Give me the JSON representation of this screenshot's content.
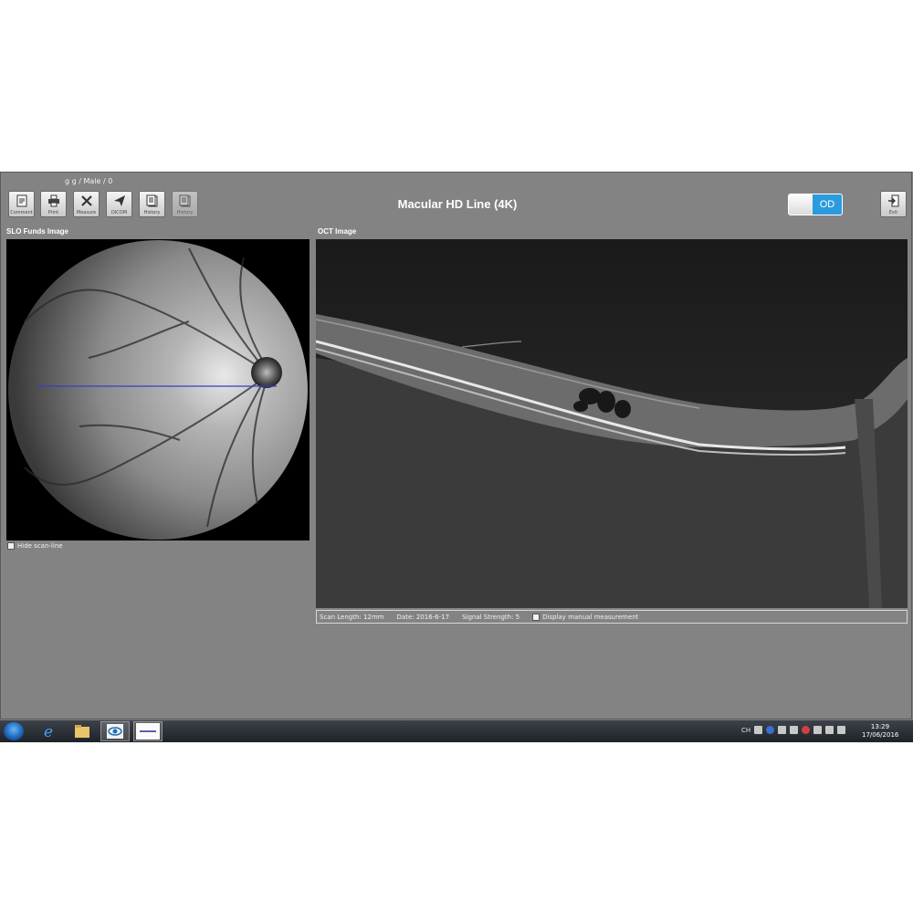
{
  "patient": {
    "info": "g  g  / Male / 0"
  },
  "toolbar": {
    "buttons": [
      {
        "label": "Comment",
        "icon": "comment-icon"
      },
      {
        "label": "Print",
        "icon": "print-icon"
      },
      {
        "label": "Measure",
        "icon": "measure-icon"
      },
      {
        "label": "DICOM",
        "icon": "dicom-icon"
      },
      {
        "label": "History",
        "icon": "history-icon"
      },
      {
        "label": "History",
        "icon": "history-icon"
      }
    ],
    "exit_label": "Exit"
  },
  "window": {
    "title": "Macular HD Line (4K)"
  },
  "eye_toggle": {
    "value": "OD",
    "color": "#2b9be0"
  },
  "slo": {
    "title": "SLO Funds Image",
    "hide_scanline_label": "Hide scan-line",
    "scanline_color": "#3a3acc"
  },
  "oct": {
    "title": "OCT Image",
    "scan_length": "Scan Length: 12mm",
    "date": "Date: 2016-6-17",
    "signal_strength": "Signal Strength: 5",
    "manual_measurement_label": "Display manual measurement"
  },
  "taskbar": {
    "items": [
      "start-orb-icon",
      "internet-explorer-icon",
      "file-explorer-icon",
      "oct-app-icon",
      "scan-window-icon"
    ],
    "tray_language": "CH",
    "time": "13:29",
    "date": "17/06/2016"
  }
}
